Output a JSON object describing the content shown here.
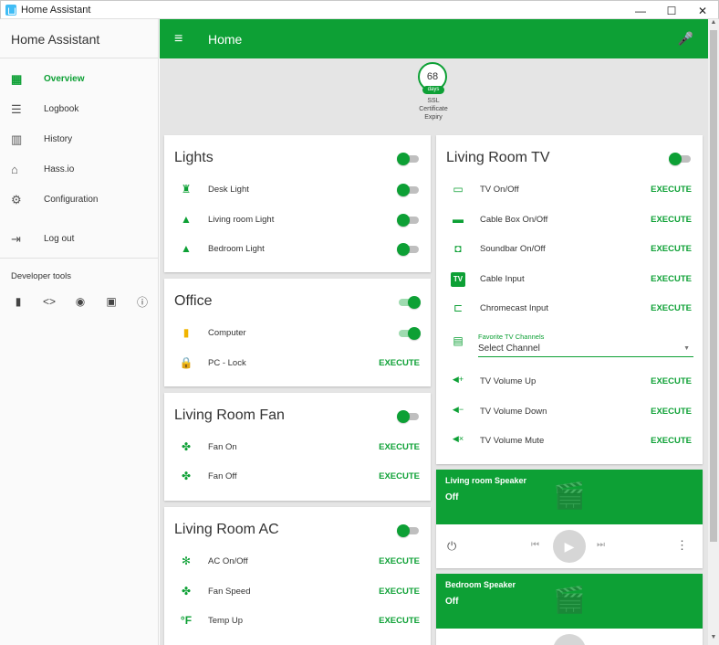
{
  "window": {
    "title": "Home Assistant",
    "minimize": "—",
    "maximize": "☐",
    "close": "✕"
  },
  "sidebar": {
    "title": "Home Assistant",
    "items": [
      {
        "label": "Overview",
        "icon": "grid-icon",
        "glyph": "▦"
      },
      {
        "label": "Logbook",
        "icon": "list-icon",
        "glyph": "☰"
      },
      {
        "label": "History",
        "icon": "chart-icon",
        "glyph": "▥"
      },
      {
        "label": "Hass.io",
        "icon": "home-assistant-icon",
        "glyph": "⌂"
      },
      {
        "label": "Configuration",
        "icon": "gear-icon",
        "glyph": "⚙"
      },
      {
        "label": "Log out",
        "icon": "logout-icon",
        "glyph": "⇥"
      }
    ],
    "dev_tools_label": "Developer tools",
    "dev_tools": [
      {
        "icon": "remote-icon",
        "glyph": "▮"
      },
      {
        "icon": "code-icon",
        "glyph": "<>"
      },
      {
        "icon": "broadcast-icon",
        "glyph": "◉"
      },
      {
        "icon": "file-code-icon",
        "glyph": "▣"
      },
      {
        "icon": "info-icon",
        "glyph": "ⓘ"
      }
    ]
  },
  "header": {
    "title": "Home",
    "menu_glyph": "≡",
    "mic_glyph": "🎤"
  },
  "badge": {
    "value": "68",
    "unit": "days",
    "label_1": "SSL",
    "label_2": "Certificate",
    "label_3": "Expiry"
  },
  "cards": {
    "lights": {
      "title": "Lights",
      "rows": [
        {
          "label": "Desk Light",
          "icon": "lamp-icon",
          "glyph": "♜"
        },
        {
          "label": "Living room Light",
          "icon": "ceiling-light-icon",
          "glyph": "▲"
        },
        {
          "label": "Bedroom Light",
          "icon": "ceiling-light-icon",
          "glyph": "▲"
        }
      ]
    },
    "office": {
      "title": "Office",
      "rows": [
        {
          "label": "Computer",
          "icon": "desktop-tower-icon",
          "glyph": "▮"
        },
        {
          "label": "PC - Lock",
          "icon": "lock-icon",
          "glyph": "🔒",
          "action": "EXECUTE"
        }
      ]
    },
    "fan": {
      "title": "Living Room Fan",
      "rows": [
        {
          "label": "Fan On",
          "icon": "fan-icon",
          "glyph": "✤",
          "action": "EXECUTE"
        },
        {
          "label": "Fan Off",
          "icon": "fan-icon",
          "glyph": "✤",
          "action": "EXECUTE"
        }
      ]
    },
    "ac": {
      "title": "Living Room AC",
      "rows": [
        {
          "label": "AC On/Off",
          "icon": "air-conditioner-icon",
          "glyph": "✻",
          "action": "EXECUTE"
        },
        {
          "label": "Fan Speed",
          "icon": "fan-icon",
          "glyph": "✤",
          "action": "EXECUTE"
        },
        {
          "label": "Temp Up",
          "icon": "temperature-fahrenheit-icon",
          "glyph": "°F",
          "action": "EXECUTE"
        }
      ]
    },
    "tv": {
      "title": "Living Room TV",
      "rows": [
        {
          "label": "TV On/Off",
          "icon": "television-icon",
          "glyph": "▭",
          "action": "EXECUTE"
        },
        {
          "label": "Cable Box On/Off",
          "icon": "router-icon",
          "glyph": "▬",
          "action": "EXECUTE"
        },
        {
          "label": "Soundbar On/Off",
          "icon": "speaker-icon",
          "glyph": "◘",
          "action": "EXECUTE"
        },
        {
          "label": "Cable Input",
          "icon": "tv-box-icon",
          "glyph": "TV",
          "action": "EXECUTE"
        },
        {
          "label": "Chromecast Input",
          "icon": "cast-icon",
          "glyph": "⊏",
          "action": "EXECUTE"
        }
      ],
      "select": {
        "label": "Favorite TV Channels",
        "value": "Select Channel",
        "icon": "channel-list-icon",
        "glyph": "▤"
      },
      "rows2": [
        {
          "label": "TV Volume Up",
          "icon": "volume-plus-icon",
          "glyph": "◀+",
          "action": "EXECUTE"
        },
        {
          "label": "TV Volume Down",
          "icon": "volume-minus-icon",
          "glyph": "◀−",
          "action": "EXECUTE"
        },
        {
          "label": "TV Volume Mute",
          "icon": "volume-mute-icon",
          "glyph": "◀×",
          "action": "EXECUTE"
        }
      ]
    },
    "speaker_living": {
      "name": "Living room Speaker",
      "state": "Off"
    },
    "speaker_bedroom": {
      "name": "Bedroom Speaker",
      "state": "Off"
    }
  },
  "media_glyphs": {
    "art": "🎬",
    "power": "⏻",
    "prev": "⏮",
    "play": "▶",
    "next": "⏭",
    "more": "⋮"
  },
  "colors": {
    "accent": "#0da035",
    "background": "#e5e5e5"
  }
}
